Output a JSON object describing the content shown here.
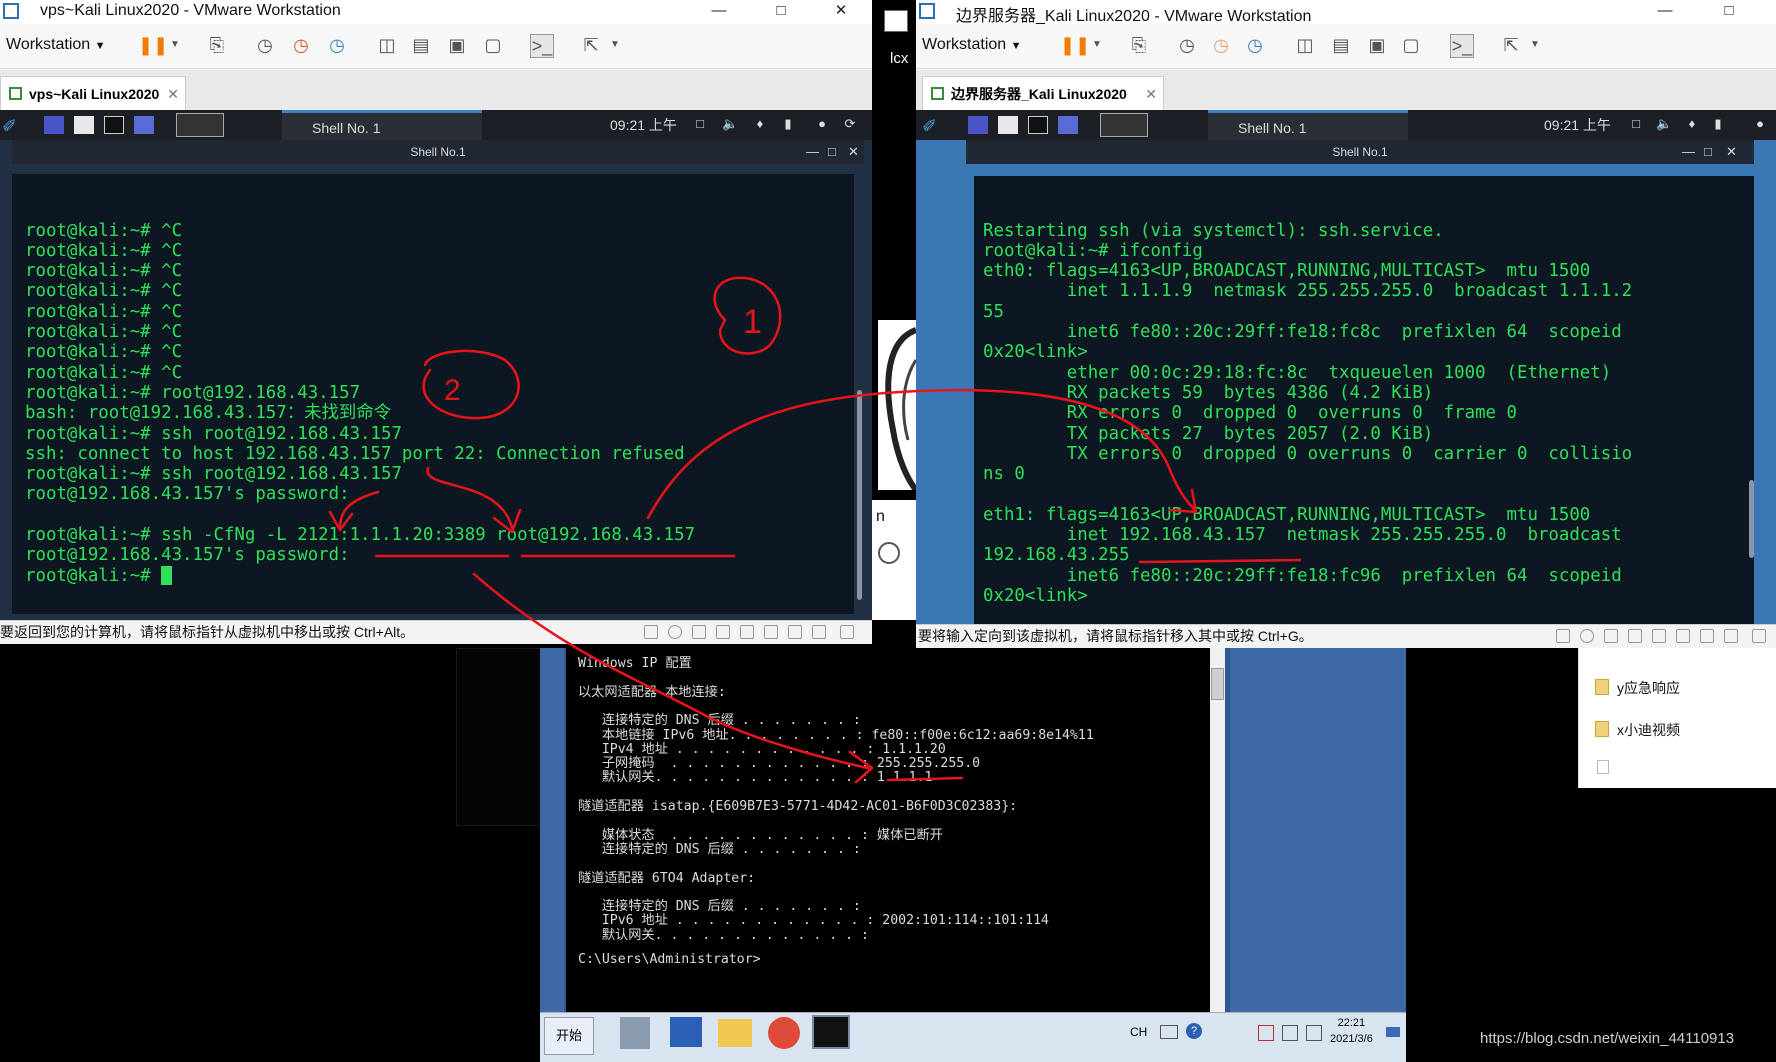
{
  "left_window": {
    "title": "vps~Kali Linux2020 - VMware Workstation",
    "workstation_menu": "Workstation",
    "tab_label": "vps~Kali Linux2020",
    "panel_shell_tab": "Shell No. 1",
    "panel_clock": "09:21 上午",
    "terminal_title": "Shell No.1",
    "terminal_lines": [
      "root@kali:~# ^C",
      "root@kali:~# ^C",
      "root@kali:~# ^C",
      "root@kali:~# ^C",
      "root@kali:~# ^C",
      "root@kali:~# ^C",
      "root@kali:~# ^C",
      "root@kali:~# ^C",
      "root@kali:~# root@192.168.43.157",
      "bash: root@192.168.43.157：未找到命令",
      "root@kali:~# ssh root@192.168.43.157",
      "ssh: connect to host 192.168.43.157 port 22: Connection refused",
      "root@kali:~# ssh root@192.168.43.157",
      "root@192.168.43.157's password:",
      "",
      "root@kali:~# ssh -CfNg -L 2121:1.1.1.20:3389 root@192.168.43.157",
      "root@192.168.43.157's password:",
      "root@kali:~# "
    ],
    "status_text": "要返回到您的计算机，请将鼠标指针从虚拟机中移出或按 Ctrl+Alt。"
  },
  "right_window": {
    "title": "边界服务器_Kali Linux2020 - VMware Workstation",
    "workstation_menu": "Workstation",
    "tab_label": "边界服务器_Kali Linux2020",
    "panel_shell_tab": "Shell No. 1",
    "panel_clock": "09:21 上午",
    "terminal_title": "Shell No.1",
    "terminal_lines": [
      "Restarting ssh (via systemctl): ssh.service.",
      "root@kali:~# ifconfig",
      "eth0: flags=4163<UP,BROADCAST,RUNNING,MULTICAST>  mtu 1500",
      "        inet 1.1.1.9  netmask 255.255.255.0  broadcast 1.1.1.2",
      "55",
      "        inet6 fe80::20c:29ff:fe18:fc8c  prefixlen 64  scopeid",
      "0x20<link>",
      "        ether 00:0c:29:18:fc:8c  txqueuelen 1000  (Ethernet)",
      "        RX packets 59  bytes 4386 (4.2 KiB)",
      "        RX errors 0  dropped 0  overruns 0  frame 0",
      "        TX packets 27  bytes 2057 (2.0 KiB)",
      "        TX errors 0  dropped 0 overruns 0  carrier 0  collisio",
      "ns 0",
      "",
      "eth1: flags=4163<UP,BROADCAST,RUNNING,MULTICAST>  mtu 1500",
      "        inet 192.168.43.157  netmask 255.255.255.0  broadcast",
      "192.168.43.255",
      "        inet6 fe80::20c:29ff:fe18:fc96  prefixlen 64  scopeid",
      "0x20<link>"
    ],
    "status_text": "要将输入定向到该虚拟机，请将鼠标指针移入其中或按 Ctrl+G。"
  },
  "middle_strip": {
    "label_top": "lcx",
    "label_n": "n"
  },
  "windows_cmd": {
    "lines": [
      "Windows IP 配置",
      "",
      "以太网适配器 本地连接:",
      "",
      "   连接特定的 DNS 后缀 . . . . . . . :",
      "   本地链接 IPv6 地址. . . . . . . . : fe80::f00e:6c12:aa69:8e14%11",
      "   IPv4 地址 . . . . . . . . . . . . : 1.1.1.20",
      "   子网掩码  . . . . . . . . . . . . : 255.255.255.0",
      "   默认网关. . . . . . . . . . . . . : 1.1.1.1",
      "",
      "隧道适配器 isatap.{E609B7E3-5771-4D42-AC01-B6F0D3C02383}:",
      "",
      "   媒体状态  . . . . . . . . . . . . : 媒体已断开",
      "   连接特定的 DNS 后缀 . . . . . . . :",
      "",
      "隧道适配器 6TO4 Adapter:",
      "",
      "   连接特定的 DNS 后缀 . . . . . . . :",
      "   IPv6 地址 . . . . . . . . . . . . : 2002:101:114::101:114",
      "   默认网关. . . . . . . . . . . . . :",
      "",
      "C:\\Users\\Administrator>"
    ],
    "taskbar": {
      "start_label": "开始",
      "lang": "CH",
      "time": "22:21",
      "date": "2021/3/6"
    }
  },
  "desktop_right": {
    "items": [
      "y应急响应",
      "x小迪视频"
    ]
  },
  "watermark": "https://blog.csdn.net/weixin_44110913",
  "annotations": {
    "circle_1": "1",
    "circle_2": "2"
  },
  "colors": {
    "terminal_text": "#2ee05a",
    "terminal_bg": "#0c1721",
    "annotation": "#e8141c"
  }
}
